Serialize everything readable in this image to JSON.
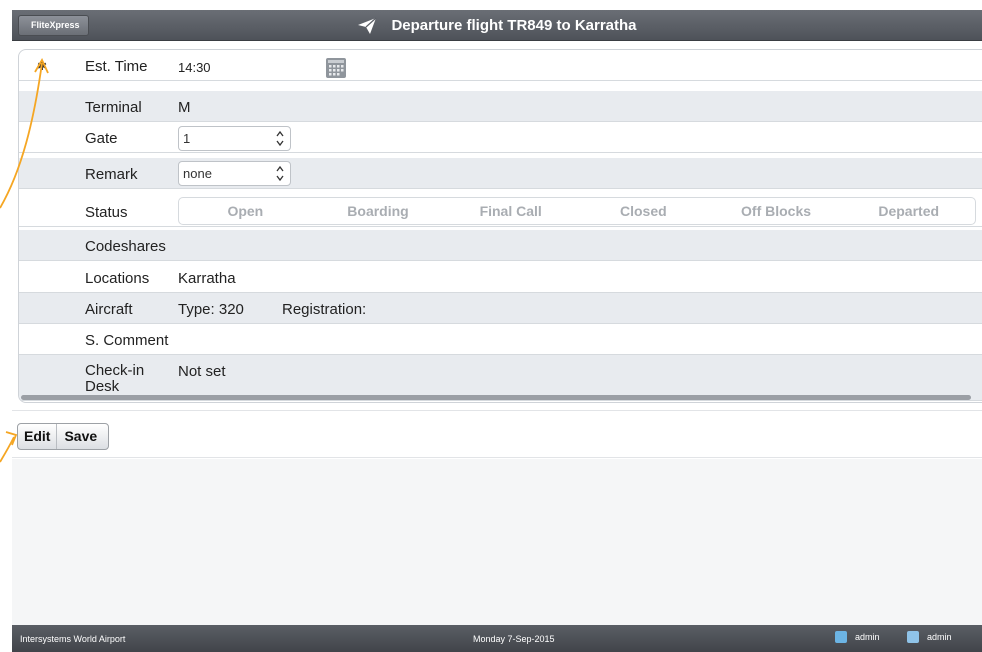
{
  "header": {
    "back_label": "FliteXpress",
    "title": "Departure flight TR849 to Karratha"
  },
  "form": {
    "est_time_label": "Est. Time",
    "est_time_value": "14:30",
    "terminal_label": "Terminal",
    "terminal_value": "M",
    "gate_label": "Gate",
    "gate_value": "1",
    "remark_label": "Remark",
    "remark_value": "none",
    "status_label": "Status",
    "status_options": [
      "Open",
      "Boarding",
      "Final Call",
      "Closed",
      "Off Blocks",
      "Departed"
    ],
    "codeshares_label": "Codeshares",
    "locations_label": "Locations",
    "locations_value": "Karratha",
    "aircraft_label": "Aircraft",
    "aircraft_type": "Type: 320",
    "aircraft_registration": "Registration:",
    "scomment_label": "S. Comment",
    "checkin_label": "Check-in Desk",
    "checkin_value": "Not set"
  },
  "toolbar": {
    "edit_label": "Edit",
    "save_label": "Save"
  },
  "footer": {
    "airport": "Intersystems World Airport",
    "date": "Monday 7-Sep-2015",
    "user1": "admin",
    "user2": "admin"
  },
  "colors": {
    "header": "#55595f",
    "annotation": "#f5a623",
    "alt_row": "#e8ebef"
  }
}
